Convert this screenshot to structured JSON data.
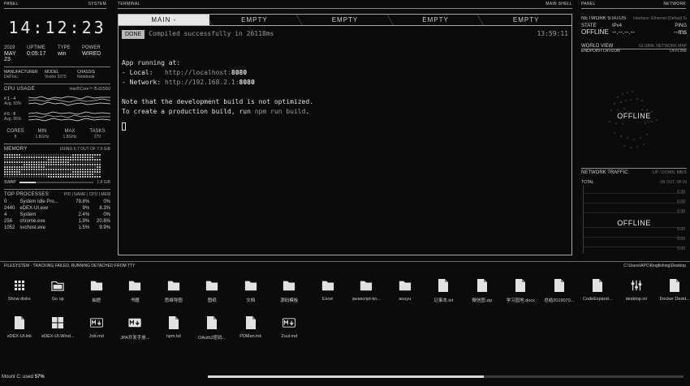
{
  "headers": {
    "left_panel": "PANEL",
    "left_system": "SYSTEM",
    "terminal": "TERMINAL",
    "main_shell": "MAIN SHELL",
    "right_panel": "PANEL",
    "right_network": "NETWORK"
  },
  "system": {
    "time": "14:12:23",
    "info": [
      {
        "k": "2019",
        "v": "MAY 23"
      },
      {
        "k": "UPTIME",
        "v": "0:05:17"
      },
      {
        "k": "TYPE",
        "v": "win"
      },
      {
        "k": "POWER",
        "v": "WIRED"
      }
    ],
    "hw": [
      {
        "k": "MANUFACTURER",
        "v": "Dell Inc."
      },
      {
        "k": "MODEL",
        "v": "Vostro 5370"
      },
      {
        "k": "CHASSIS",
        "v": "Notebook"
      }
    ],
    "cpu_title": "CPU USAGE",
    "cpu_model": "Intel®Core™ i5-8250U",
    "cpu_groups": [
      {
        "label": "# 1 - 4",
        "avg": "Avg. 93%"
      },
      {
        "label": "# 5 - 8",
        "avg": "Avg. 95%"
      }
    ],
    "cpu_stats": [
      {
        "k": "CORES",
        "v": "8"
      },
      {
        "k": "MIN",
        "v": "1.8GHz"
      },
      {
        "k": "MAX",
        "v": "1.8GHz"
      },
      {
        "k": "TASKS",
        "v": "270"
      }
    ],
    "memory_title": "MEMORY",
    "memory_usage": "USING 6.7 OUT OF 7.9 GiB",
    "swap_label": "SWAP",
    "swap_value": "1.8 GiB",
    "swap_fill": 0.22,
    "proc_title": "TOP PROCESSES",
    "proc_cols": "PID | NAME | CPU | MEM",
    "processes": [
      {
        "pid": "0",
        "name": "System Idle Pro...",
        "cpu": "79.8%",
        "mem": "0%"
      },
      {
        "pid": "2440",
        "name": "eDEX-UI.exe",
        "cpu": "9%",
        "mem": "8.3%"
      },
      {
        "pid": "4",
        "name": "System",
        "cpu": "2.4%",
        "mem": "0%"
      },
      {
        "pid": "256",
        "name": "chrome.exe",
        "cpu": "1.9%",
        "mem": "20.8%"
      },
      {
        "pid": "1052",
        "name": "svchost.exe",
        "cpu": "1.5%",
        "mem": "9.9%"
      }
    ]
  },
  "terminal": {
    "tabs": [
      {
        "label": "MAIN -",
        "active": true
      },
      {
        "label": "EMPTY",
        "active": false
      },
      {
        "label": "EMPTY",
        "active": false
      },
      {
        "label": "EMPTY",
        "active": false
      },
      {
        "label": "EMPTY",
        "active": false
      }
    ],
    "badge": "DONE",
    "status_msg": "Compiled successfully in 26118ms",
    "status_time": "13:59:11",
    "running": "App running at:",
    "local_label": "- Local:",
    "local_url_pre": "http://localhost:",
    "local_port": "8080",
    "network_label": "- Network:",
    "network_url_pre": "http://192.168.2.1:",
    "network_port": "8080",
    "note1": "Note that the development build is not optimized.",
    "note2_pre": "To create a production build, run",
    "note2_cmd": "npm run build",
    "note2_post": "."
  },
  "network": {
    "status_title": "NETWORK STATUS",
    "status_iface": "Interface: Ethernet (Default Switch)",
    "state_label": "STATE",
    "state_value": "OFFLINE",
    "ipv4_label": "IPv4",
    "ipv4_value": "--.--.--.--",
    "ping_label": "PING",
    "ping_value": "--ms",
    "world_title": "WORLD VIEW",
    "world_sub": "GLOBAL NETWORK MAP",
    "endpoint": "ENDPOINT LAT/LON",
    "endpoint_value": "OFFLINE",
    "globe_offline": "OFFLINE",
    "traffic_title": "NETWORK TRAFFIC",
    "traffic_sub": "UP / DOWN, MB/S",
    "total_label": "TOTAL",
    "total_value": "0B OUT, 0B IN",
    "traffic_offline": "OFFLINE",
    "scale_top": [
      "0.00",
      "0.00",
      "0.00"
    ],
    "scale_bot": [
      "0.00",
      "0.00",
      "0.00"
    ]
  },
  "filesystem": {
    "title": "FILESYSTEM - TRACKING FAILED, RUNNING DETACHED FROM TTY",
    "path": "C:\\Users\\APC\\Kingfishing\\Desktop",
    "row1": [
      {
        "name": "Show disks",
        "icon": "grid-icon"
      },
      {
        "name": "Go up",
        "icon": "folder-up-icon"
      },
      {
        "name": "抽屉",
        "icon": "folder-icon"
      },
      {
        "name": "书籍",
        "icon": "folder-icon"
      },
      {
        "name": "思维导图",
        "icon": "folder-icon"
      },
      {
        "name": "图纸",
        "icon": "folder-icon"
      },
      {
        "name": "文档",
        "icon": "folder-icon"
      },
      {
        "name": "源码模板",
        "icon": "folder-icon"
      },
      {
        "name": "Excel",
        "icon": "folder-icon"
      },
      {
        "name": "javascript-kn...",
        "icon": "folder-icon"
      },
      {
        "name": "aouyu",
        "icon": "folder-icon"
      },
      {
        "name": "记事本.txt",
        "icon": "file-icon"
      },
      {
        "name": "微信图.zip",
        "icon": "file-icon"
      },
      {
        "name": "学习园地.docx",
        "icon": "file-icon"
      },
      {
        "name": "总结2019070...",
        "icon": "file-icon"
      },
      {
        "name": "CodeExpand...",
        "icon": "file-icon"
      },
      {
        "name": "desktop.ini",
        "icon": "settings-icon"
      },
      {
        "name": "Docker Deskt...",
        "icon": "file-icon"
      }
    ],
    "row2": [
      {
        "name": "eDEX-UI.lnk",
        "icon": "file-icon"
      },
      {
        "name": "eDEX-UI.Wind...",
        "icon": "windows-icon"
      },
      {
        "name": "Job.md",
        "icon": "markdown-icon"
      },
      {
        "name": "JPA开发手册...",
        "icon": "markdown-down-icon"
      },
      {
        "name": "npm.txt",
        "icon": "file-icon"
      },
      {
        "name": "OAuth2密码...",
        "icon": "file-icon"
      },
      {
        "name": "PDMan.lnk",
        "icon": "file-icon"
      },
      {
        "name": "Zuul.md",
        "icon": "markdown-icon"
      }
    ],
    "mount": "Mount C: used",
    "mount_pct": "57%",
    "disk_fill": 0.58
  }
}
